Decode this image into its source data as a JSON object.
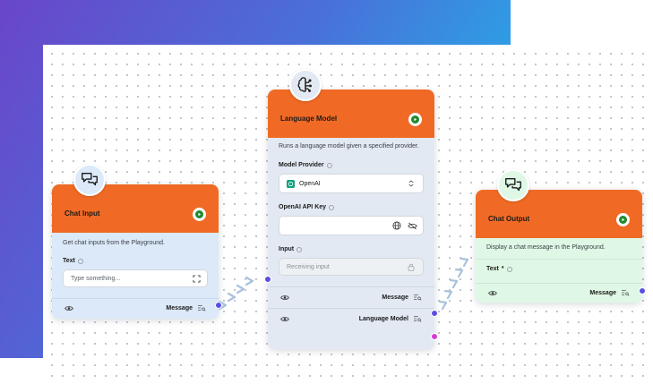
{
  "nodes": {
    "chat_input": {
      "title": "Chat Input",
      "description": "Get chat inputs from the Playground.",
      "field_label": "Text",
      "placeholder": "Type something...",
      "output_label": "Message"
    },
    "language_model": {
      "title": "Language Model",
      "description": "Runs a language model given a specified provider.",
      "provider_label": "Model Provider",
      "provider_value": "OpenAI",
      "api_key_label": "OpenAI API Key",
      "input_label": "Input",
      "input_placeholder": "Receiving input",
      "output_message": "Message",
      "output_model": "Language Model"
    },
    "chat_output": {
      "title": "Chat Output",
      "description": "Display a chat message in the Playground.",
      "field_label": "Text",
      "required_mark": "*",
      "output_label": "Message"
    }
  },
  "colors": {
    "header": "#f06a25",
    "chat_input_body": "#dbe9f9",
    "language_model_body": "#e2e9f3",
    "chat_output_body": "#dff8e5",
    "port_message": "#5b4fe0",
    "port_model": "#d53ad6",
    "edge": "#a9c1dc"
  },
  "icons": [
    "chat-bubbles-icon",
    "brain-icon",
    "play-icon",
    "eye-icon",
    "fullscreen-icon",
    "globe-icon",
    "eye-off-icon",
    "lock-icon",
    "chevron-updown-icon",
    "openai-icon",
    "info-icon",
    "list-search-icon"
  ]
}
